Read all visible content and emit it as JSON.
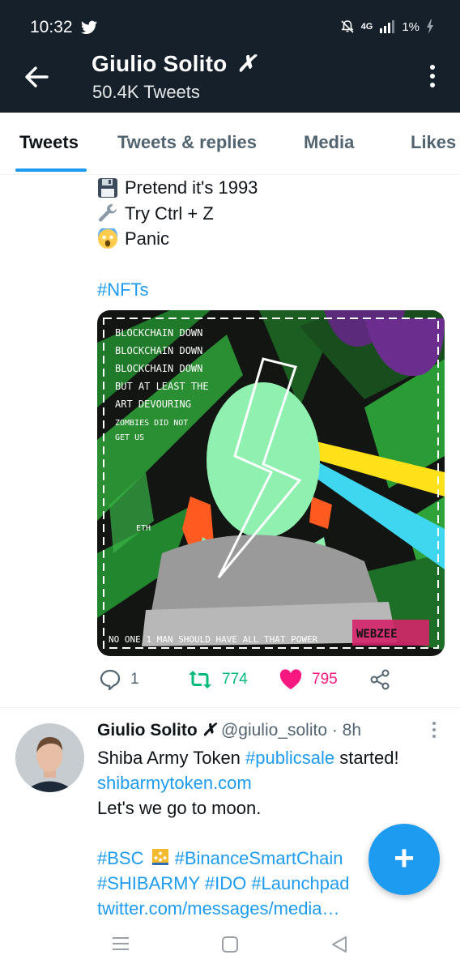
{
  "status": {
    "time": "10:32",
    "network": "4G",
    "battery": "1%"
  },
  "header": {
    "name": "Giulio Solito",
    "name_badge": "✗",
    "tweet_count": "50.4K Tweets"
  },
  "tabs": [
    "Tweets",
    "Tweets & replies",
    "Media",
    "Likes"
  ],
  "tweet1": {
    "lines": [
      {
        "icon": "floppy-disk-icon",
        "text": "Pretend it's 1993"
      },
      {
        "icon": "wrench-icon",
        "text": "Try Ctrl + Z"
      },
      {
        "icon": "screaming-face-icon",
        "text": "Panic"
      }
    ],
    "hashtag": "#NFTs",
    "art": {
      "text_lines": [
        "BLOCKCHAIN DOWN",
        "BLOCKCHAIN DOWN",
        "BLOCKCHAIN DOWN",
        "BUT AT LEAST THE",
        "ART DEVOURING",
        "ZOMBIES DID NOT",
        "GET US"
      ],
      "eth_label": "ETH",
      "bottom_caption": "NO ONE 1 MAN SHOULD HAVE ALL THAT POWER",
      "signature": "WEBZEE"
    },
    "replies": "1",
    "retweets": "774",
    "likes": "795"
  },
  "tweet2": {
    "name": "Giulio Solito",
    "badge": "✗",
    "handle": "@giulio_solito",
    "time": "· 8h",
    "line1_text": "Shiba Army Token ",
    "line1_tag": "#publicsale",
    "line1_end": " started!",
    "link1": "shibarmytoken.com",
    "line3": "Let's we go to moon.",
    "tags_row1a": "#BSC",
    "tags_row1b": "#BinanceSmartChain",
    "tags_row2": "#SHIBARMY #IDO #Launchpad",
    "link2": "twitter.com/messages/media…"
  },
  "fab": {
    "label": "+"
  },
  "colors": {
    "header_bg": "#15202b",
    "accent": "#1d9bf0",
    "retweet": "#00ba7c",
    "like": "#f91880"
  }
}
